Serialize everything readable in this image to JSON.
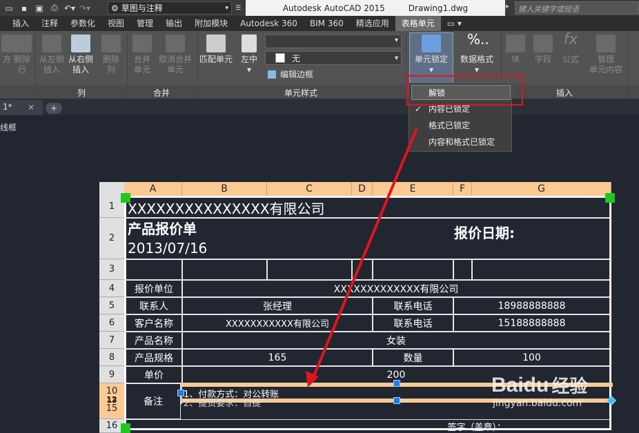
{
  "title": {
    "workspace": "草图与注释",
    "app_name": "Autodesk AutoCAD 2015",
    "file_name": "Drawing1.dwg",
    "search_placeholder": "键入关键字或短语"
  },
  "ribbon_tabs": [
    "插入",
    "注释",
    "参数化",
    "视图",
    "管理",
    "输出",
    "附加模块",
    "Autodesk 360",
    "BIM 360",
    "精选应用",
    "表格单元"
  ],
  "ribbon_tab_extra": "▭ ▾",
  "ribbon": {
    "rows_buttons": [
      {
        "label1": "从左侧",
        "label2": "插入"
      },
      {
        "label1": "从右侧",
        "label2": "插入"
      },
      {
        "label1": "删除",
        "label2": "列"
      }
    ],
    "row_insert_left_cut": {
      "label1": "方",
      "label2": "删除",
      "label3": "行"
    },
    "merge_buttons": [
      {
        "label1": "合并",
        "label2": "单元"
      },
      {
        "label1": "取消合并",
        "label2": "单元"
      }
    ],
    "match_cell": "匹配单元",
    "align": "左中",
    "fill_value": "无",
    "edit_borders": "编辑边框",
    "cell_lock": "单元锁定",
    "data_format": "数据格式",
    "insert_buttons": [
      "块",
      "字段",
      "公式",
      "管理",
      "单元内容"
    ],
    "insert_manage_label2": "单元内容",
    "panel_labels": {
      "columns": "列",
      "merge": "合并",
      "cell_styles": "单元样式",
      "insert": "插入"
    }
  },
  "document_tab": {
    "label": "1*",
    "add_symbol": "+"
  },
  "viewport_label": "线框",
  "lock_menu": {
    "items": [
      {
        "label": "解锁",
        "checked": false,
        "highlighted": true
      },
      {
        "label": "内容已锁定",
        "checked": true
      },
      {
        "label": "格式已锁定",
        "checked": false
      },
      {
        "label": "内容和格式已锁定",
        "checked": false
      }
    ]
  },
  "table": {
    "columns": [
      "A",
      "B",
      "C",
      "D",
      "E",
      "F",
      "G"
    ],
    "rows": {
      "r1": {
        "num": "1",
        "text": "XXXXXXXXXXXXXXX有限公司"
      },
      "r2": {
        "num": "2",
        "title": "产品报价单",
        "date": "2013/07/16",
        "date_label": "报价日期:"
      },
      "r3": {
        "num": "3"
      },
      "r4": {
        "num": "4",
        "label": "报价单位",
        "value": "XXXXXXXXXXXXX有限公司"
      },
      "r5": {
        "num": "5",
        "label": "联系人",
        "value": "张经理",
        "label2": "联系电话",
        "value2": "18988888888"
      },
      "r6": {
        "num": "6",
        "label": "客户名称",
        "value": "XXXXXXXXXXX有限公司",
        "label2": "联系电话",
        "value2": "15188888888"
      },
      "r7": {
        "num": "7",
        "label": "产品名称",
        "value": "女装"
      },
      "r8": {
        "num": "8",
        "label": "产品规格",
        "value": "165",
        "label2": "数量",
        "value2": "100"
      },
      "r9": {
        "num": "9",
        "label": "单价",
        "value": "200"
      },
      "r10": {
        "num": "10",
        "num_overlap": "12",
        "num_b": "13",
        "num_c": "15",
        "label": "备注",
        "line1": "1、付款方式：对公转账",
        "line2": "2、提货要求：自提"
      },
      "r16": {
        "num": "16",
        "value": "签字（盖章）："
      }
    }
  },
  "watermark": {
    "brand": "Baidu",
    "brand_cn": "经验",
    "url": "jingyan.baidu.com"
  },
  "colors": {
    "accent_red": "#e0141e",
    "header_orange": "#fbc994",
    "grip_green": "#1ec81e",
    "handle_blue": "#1e7fe6"
  }
}
